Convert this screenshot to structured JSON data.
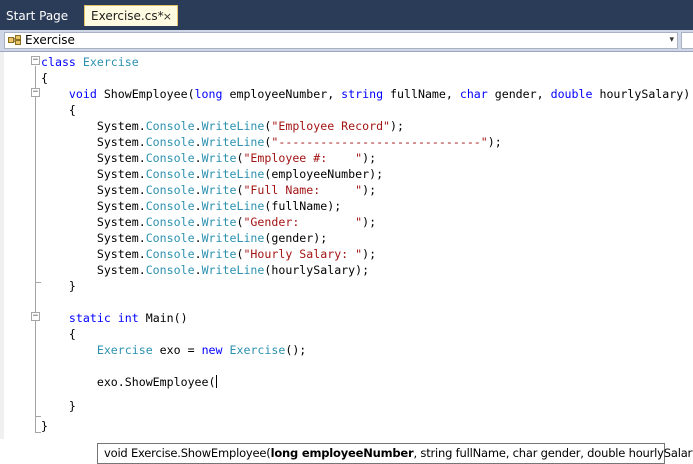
{
  "tabs": [
    {
      "label": "Start Page",
      "active": false
    },
    {
      "label": "Exercise.cs*",
      "active": true
    }
  ],
  "tab_close_glyph": "×",
  "navigation": {
    "class_combo": "Exercise",
    "combo_arrow": "▾"
  },
  "code_lines": [
    [
      {
        "t": "class",
        "c": "kw"
      },
      {
        "t": " "
      },
      {
        "t": "Exercise",
        "c": "ty"
      }
    ],
    [
      {
        "t": "{"
      }
    ],
    [
      {
        "t": "    "
      },
      {
        "t": "void",
        "c": "kw"
      },
      {
        "t": " ShowEmployee("
      },
      {
        "t": "long",
        "c": "kw"
      },
      {
        "t": " employeeNumber, "
      },
      {
        "t": "string",
        "c": "kw"
      },
      {
        "t": " fullName, "
      },
      {
        "t": "char",
        "c": "kw"
      },
      {
        "t": " gender, "
      },
      {
        "t": "double",
        "c": "kw"
      },
      {
        "t": " hourlySalary)"
      }
    ],
    [
      {
        "t": "    {"
      }
    ],
    [
      {
        "t": "        System."
      },
      {
        "t": "Console",
        "c": "ty"
      },
      {
        "t": "."
      },
      {
        "t": "WriteLine",
        "c": "ty"
      },
      {
        "t": "("
      },
      {
        "t": "\"Employee Record\"",
        "c": "st"
      },
      {
        "t": ");"
      }
    ],
    [
      {
        "t": "        System."
      },
      {
        "t": "Console",
        "c": "ty"
      },
      {
        "t": "."
      },
      {
        "t": "WriteLine",
        "c": "ty"
      },
      {
        "t": "("
      },
      {
        "t": "\"-----------------------------\"",
        "c": "st"
      },
      {
        "t": ");"
      }
    ],
    [
      {
        "t": "        System."
      },
      {
        "t": "Console",
        "c": "ty"
      },
      {
        "t": "."
      },
      {
        "t": "Write",
        "c": "ty"
      },
      {
        "t": "("
      },
      {
        "t": "\"Employee #:    \"",
        "c": "st"
      },
      {
        "t": ");"
      }
    ],
    [
      {
        "t": "        System."
      },
      {
        "t": "Console",
        "c": "ty"
      },
      {
        "t": "."
      },
      {
        "t": "WriteLine",
        "c": "ty"
      },
      {
        "t": "(employeeNumber);"
      }
    ],
    [
      {
        "t": "        System."
      },
      {
        "t": "Console",
        "c": "ty"
      },
      {
        "t": "."
      },
      {
        "t": "Write",
        "c": "ty"
      },
      {
        "t": "("
      },
      {
        "t": "\"Full Name:     \"",
        "c": "st"
      },
      {
        "t": ");"
      }
    ],
    [
      {
        "t": "        System."
      },
      {
        "t": "Console",
        "c": "ty"
      },
      {
        "t": "."
      },
      {
        "t": "WriteLine",
        "c": "ty"
      },
      {
        "t": "(fullName);"
      }
    ],
    [
      {
        "t": "        System."
      },
      {
        "t": "Console",
        "c": "ty"
      },
      {
        "t": "."
      },
      {
        "t": "Write",
        "c": "ty"
      },
      {
        "t": "("
      },
      {
        "t": "\"Gender:        \"",
        "c": "st"
      },
      {
        "t": ");"
      }
    ],
    [
      {
        "t": "        System."
      },
      {
        "t": "Console",
        "c": "ty"
      },
      {
        "t": "."
      },
      {
        "t": "WriteLine",
        "c": "ty"
      },
      {
        "t": "(gender);"
      }
    ],
    [
      {
        "t": "        System."
      },
      {
        "t": "Console",
        "c": "ty"
      },
      {
        "t": "."
      },
      {
        "t": "Write",
        "c": "ty"
      },
      {
        "t": "("
      },
      {
        "t": "\"Hourly Salary: \"",
        "c": "st"
      },
      {
        "t": ");"
      }
    ],
    [
      {
        "t": "        System."
      },
      {
        "t": "Console",
        "c": "ty"
      },
      {
        "t": "."
      },
      {
        "t": "WriteLine",
        "c": "ty"
      },
      {
        "t": "(hourlySalary);"
      }
    ],
    [
      {
        "t": "    }"
      }
    ],
    [],
    [
      {
        "t": "    "
      },
      {
        "t": "static",
        "c": "kw"
      },
      {
        "t": " "
      },
      {
        "t": "int",
        "c": "kw"
      },
      {
        "t": " Main()"
      }
    ],
    [
      {
        "t": "    {"
      }
    ],
    [
      {
        "t": "        "
      },
      {
        "t": "Exercise",
        "c": "ty"
      },
      {
        "t": " exo = "
      },
      {
        "t": "new",
        "c": "kw"
      },
      {
        "t": " "
      },
      {
        "t": "Exercise",
        "c": "ty"
      },
      {
        "t": "();"
      }
    ],
    [],
    [
      {
        "t": "        exo.ShowEmployee("
      },
      {
        "caret": true
      }
    ],
    [
      {
        "t": "    }"
      }
    ],
    [
      {
        "t": "}"
      }
    ]
  ],
  "tooltip": {
    "before": "void Exercise.ShowEmployee(",
    "current_param": "long employeeNumber",
    "after": ", string fullName, char gender, double hourlySalary)"
  }
}
